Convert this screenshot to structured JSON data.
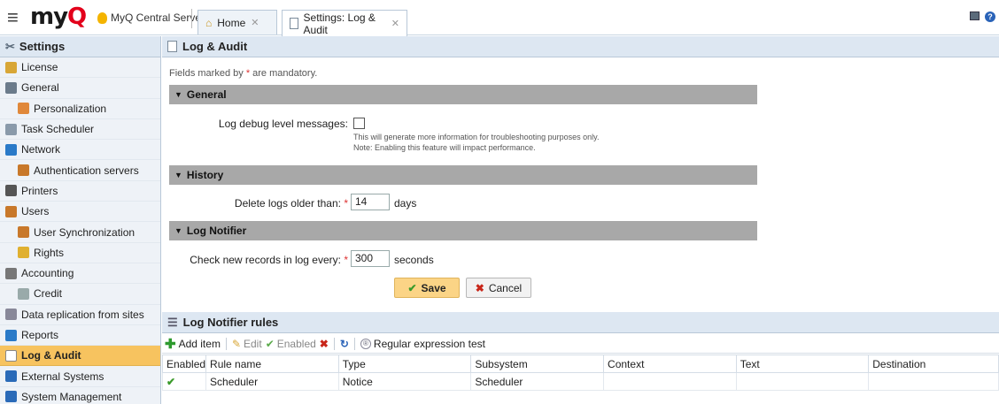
{
  "app": {
    "logo_prefix": "my",
    "logo_q": "Q",
    "server_name": "MyQ Central Server"
  },
  "tabs": [
    {
      "label": "Home",
      "active": false
    },
    {
      "label": "Settings: Log & Audit",
      "active": true
    }
  ],
  "sidebar": {
    "title": "Settings",
    "items": [
      {
        "label": "License",
        "icon": "license-icon"
      },
      {
        "label": "General",
        "icon": "tools-icon"
      },
      {
        "label": "Personalization",
        "icon": "palette-icon",
        "sub": true
      },
      {
        "label": "Task Scheduler",
        "icon": "clock-icon"
      },
      {
        "label": "Network",
        "icon": "globe-icon"
      },
      {
        "label": "Authentication servers",
        "icon": "user-icon",
        "sub": true
      },
      {
        "label": "Printers",
        "icon": "printer-icon"
      },
      {
        "label": "Users",
        "icon": "user-icon"
      },
      {
        "label": "User Synchronization",
        "icon": "user-sync-icon",
        "sub": true
      },
      {
        "label": "Rights",
        "icon": "key-icon",
        "sub": true
      },
      {
        "label": "Accounting",
        "icon": "accounting-icon"
      },
      {
        "label": "Credit",
        "icon": "credit-icon",
        "sub": true
      },
      {
        "label": "Data replication from sites",
        "icon": "replication-icon"
      },
      {
        "label": "Reports",
        "icon": "reports-icon"
      },
      {
        "label": "Log & Audit",
        "icon": "log-icon",
        "active": true
      },
      {
        "label": "External Systems",
        "icon": "external-icon"
      },
      {
        "label": "System Management",
        "icon": "system-icon"
      }
    ]
  },
  "main": {
    "title": "Log & Audit",
    "mandatory_prefix": "Fields marked by ",
    "mandatory_star": "*",
    "mandatory_suffix": " are mandatory.",
    "sections": {
      "general": "General",
      "history": "History",
      "log_notifier": "Log Notifier"
    },
    "fields": {
      "debug_label": "Log debug level messages:",
      "debug_checked": false,
      "debug_hint_1": "This will generate more information for troubleshooting purposes only.",
      "debug_hint_2": "Note: Enabling this feature will impact performance.",
      "delete_label": "Delete logs older than:",
      "delete_value": "14",
      "delete_unit": "days",
      "check_label": "Check new records in log every:",
      "check_value": "300",
      "check_unit": "seconds",
      "required_star": "*"
    },
    "buttons": {
      "save": "Save",
      "cancel": "Cancel"
    }
  },
  "rules": {
    "title": "Log Notifier rules",
    "toolbar": {
      "add": "Add item",
      "edit": "Edit",
      "enabled": "Enabled",
      "regex": "Regular expression test"
    },
    "columns": [
      "Enabled",
      "Rule name",
      "Type",
      "Subsystem",
      "Context",
      "Text",
      "Destination"
    ],
    "rows": [
      {
        "enabled": "✔",
        "rule_name": "Scheduler",
        "type": "Notice",
        "subsystem": "Scheduler",
        "context": "",
        "text": "",
        "destination": ""
      }
    ]
  },
  "colors": {
    "accent": "#f7c35f",
    "header_bg": "#dde7f2",
    "section_bg": "#a8a8a8",
    "brand_red": "#e3001b"
  }
}
